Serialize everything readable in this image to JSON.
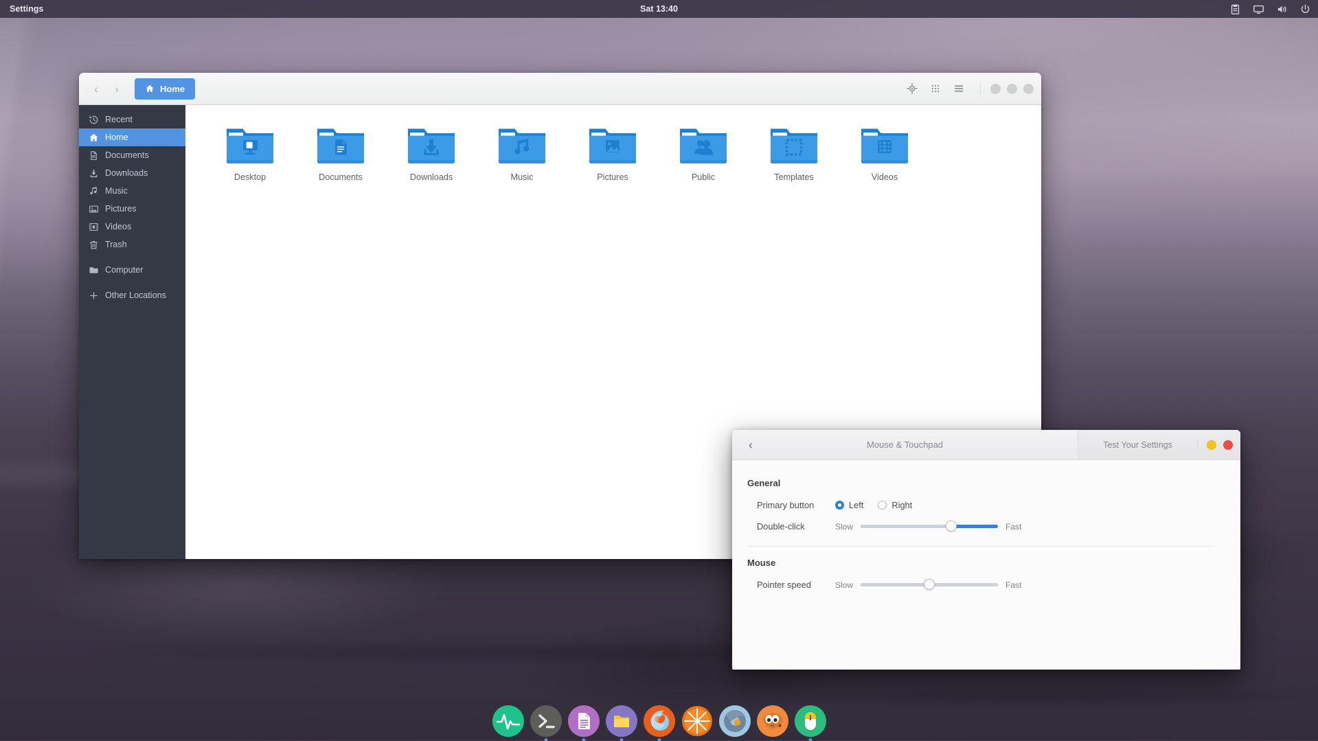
{
  "panel": {
    "app_name": "Settings",
    "clock": "Sat 13:40",
    "indicators": [
      {
        "name": "clipboard-icon"
      },
      {
        "name": "display-icon"
      },
      {
        "name": "volume-icon"
      },
      {
        "name": "power-icon"
      }
    ]
  },
  "file_manager": {
    "nav": {
      "back_label": "‹",
      "forward_label": "›"
    },
    "breadcrumb": {
      "label": "Home",
      "icon": "home-icon"
    },
    "header_icons": [
      {
        "name": "location-icon"
      },
      {
        "name": "grid-view-icon"
      },
      {
        "name": "menu-icon"
      }
    ],
    "window_buttons": [
      {
        "name": "minimize-button"
      },
      {
        "name": "maximize-button"
      },
      {
        "name": "close-button"
      }
    ],
    "sidebar": {
      "items": [
        {
          "label": "Recent",
          "icon": "clock-icon",
          "active": false
        },
        {
          "label": "Home",
          "icon": "home-icon",
          "active": true
        },
        {
          "label": "Documents",
          "icon": "document-icon",
          "active": false
        },
        {
          "label": "Downloads",
          "icon": "download-icon",
          "active": false
        },
        {
          "label": "Music",
          "icon": "music-icon",
          "active": false
        },
        {
          "label": "Pictures",
          "icon": "image-icon",
          "active": false
        },
        {
          "label": "Videos",
          "icon": "film-icon",
          "active": false
        },
        {
          "label": "Trash",
          "icon": "trash-icon",
          "active": false
        },
        {
          "label": "Computer",
          "icon": "folder-icon",
          "active": false
        },
        {
          "label": "Other Locations",
          "icon": "plus-icon",
          "active": false
        }
      ]
    },
    "files": [
      {
        "label": "Desktop",
        "glyph": "desktop-glyph"
      },
      {
        "label": "Documents",
        "glyph": "document-glyph"
      },
      {
        "label": "Downloads",
        "glyph": "download-glyph"
      },
      {
        "label": "Music",
        "glyph": "music-glyph"
      },
      {
        "label": "Pictures",
        "glyph": "image-glyph"
      },
      {
        "label": "Public",
        "glyph": "people-glyph"
      },
      {
        "label": "Templates",
        "glyph": "template-glyph"
      },
      {
        "label": "Videos",
        "glyph": "film-glyph"
      }
    ],
    "colors": {
      "accent": "#5294e2",
      "sidebar_bg": "#353945",
      "folder": "#3d9ae6",
      "folder_dark": "#1f7fd1"
    }
  },
  "settings": {
    "back_label": "‹",
    "title": "Mouse & Touchpad",
    "test_button": "Test Your Settings",
    "window_buttons": [
      {
        "name": "minimize-button",
        "color": "#f0c419"
      },
      {
        "name": "close-button",
        "color": "#ef4b4b"
      }
    ],
    "sections": [
      {
        "title": "General",
        "rows": [
          {
            "type": "radio",
            "label": "Primary button",
            "options": [
              {
                "label": "Left",
                "selected": true
              },
              {
                "label": "Right",
                "selected": false
              }
            ]
          },
          {
            "type": "slider",
            "label": "Double-click",
            "min_label": "Slow",
            "max_label": "Fast",
            "value_percent": 66,
            "fill": "right",
            "fill_color": "#3a80d8"
          }
        ]
      },
      {
        "title": "Mouse",
        "rows": [
          {
            "type": "slider",
            "label": "Pointer speed",
            "min_label": "Slow",
            "max_label": "Fast",
            "value_percent": 50,
            "fill": "none",
            "fill_color": "#3a80d8"
          }
        ]
      }
    ]
  },
  "dock": {
    "items": [
      {
        "name": "system-monitor-icon",
        "bg": "#1ec28b",
        "running": false
      },
      {
        "name": "terminal-icon",
        "bg": "#5d5d5a",
        "running": true
      },
      {
        "name": "text-editor-icon",
        "bg": "#b06fc4",
        "running": true
      },
      {
        "name": "file-manager-icon",
        "bg": "#8677c6",
        "running": true
      },
      {
        "name": "firefox-icon",
        "bg": "#e55b1f",
        "running": true
      },
      {
        "name": "orange-slice-icon",
        "bg": "#e8751a",
        "running": false
      },
      {
        "name": "chromium-icon",
        "bg": "#9cc8e3",
        "running": false
      },
      {
        "name": "gimp-icon",
        "bg": "#ef8b3c",
        "running": false
      },
      {
        "name": "mouse-settings-icon",
        "bg": "#2bbd7e",
        "running": true
      }
    ]
  }
}
